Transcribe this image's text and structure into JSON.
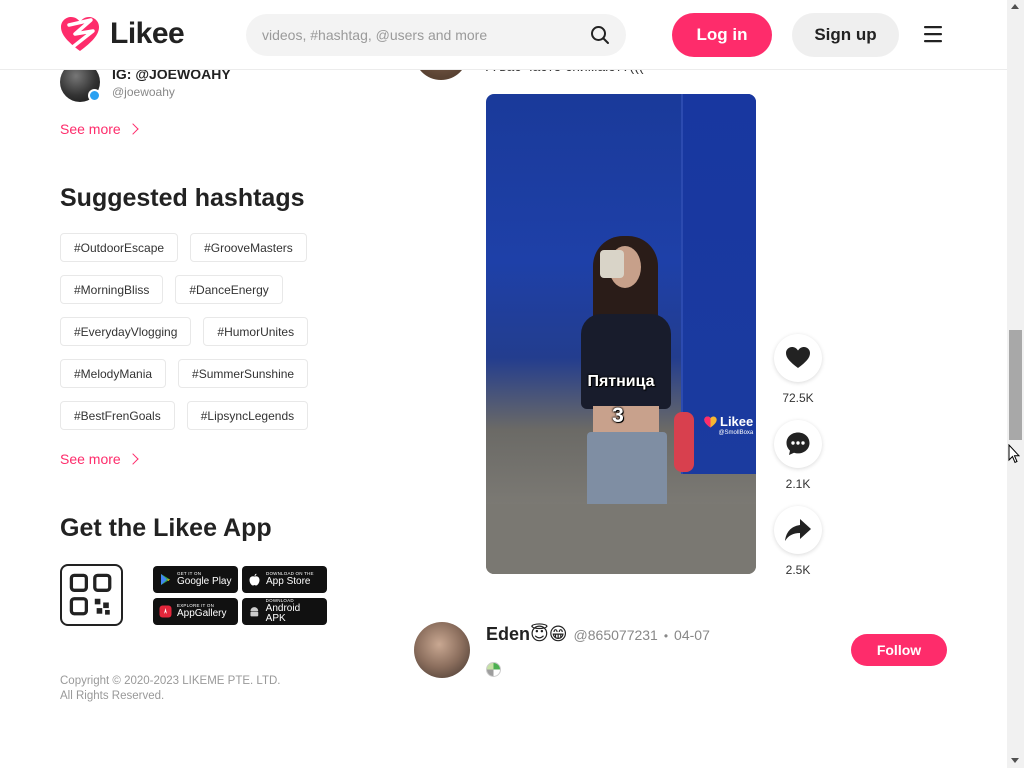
{
  "header": {
    "logo_text": "Likee",
    "search_placeholder": "videos, #hashtag, @users and more",
    "login_label": "Log in",
    "signup_label": "Sign up"
  },
  "sidebar": {
    "suggested_user": {
      "name": "IG: @JOEWOAHY",
      "handle": "@joewoahy"
    },
    "see_more_1": "See more",
    "hashtags_title": "Suggested hashtags",
    "hashtags": [
      [
        "#OutdoorEscape",
        "#GrooveMasters"
      ],
      [
        "#MorningBliss",
        "#DanceEnergy"
      ],
      [
        "#EverydayVlogging",
        "#HumorUnites"
      ],
      [
        "#MelodyMania",
        "#SummerSunshine"
      ],
      [
        "#BestFrenGoals",
        "#LipsyncLegends"
      ]
    ],
    "see_more_2": "See more",
    "app_title": "Get the Likee App",
    "stores": [
      {
        "small": "GET IT ON",
        "big": "Google Play",
        "icon": "google-play-icon"
      },
      {
        "small": "DOWNLOAD ON THE",
        "big": "App Store",
        "icon": "apple-icon"
      },
      {
        "small": "EXPLORE IT ON",
        "big": "AppGallery",
        "icon": "huawei-icon"
      },
      {
        "small": "DOWNLOAD",
        "big": "Android APK",
        "icon": "android-icon"
      }
    ],
    "copyright_line1": "Copyright © 2020-2023 LIKEME PTE. LTD.",
    "copyright_line2": "All Rights Reserved."
  },
  "feed": {
    "prev_caption": "А вас часто снимают?(((",
    "video": {
      "overlay_line1": "Пятница",
      "overlay_line2": "3",
      "watermark": "Likee",
      "watermark_handle": "@SmollBoxa"
    },
    "actions": {
      "likes": "72.5K",
      "comments": "2.1K",
      "shares": "2.5K"
    },
    "next_post": {
      "name": "Eden😇😁",
      "handle": "@865077231",
      "separator": "•",
      "date": "04-07",
      "follow_label": "Follow"
    }
  },
  "colors": {
    "brand_pink": "#fe2c6b",
    "text_dark": "#222222",
    "muted": "#888888"
  }
}
